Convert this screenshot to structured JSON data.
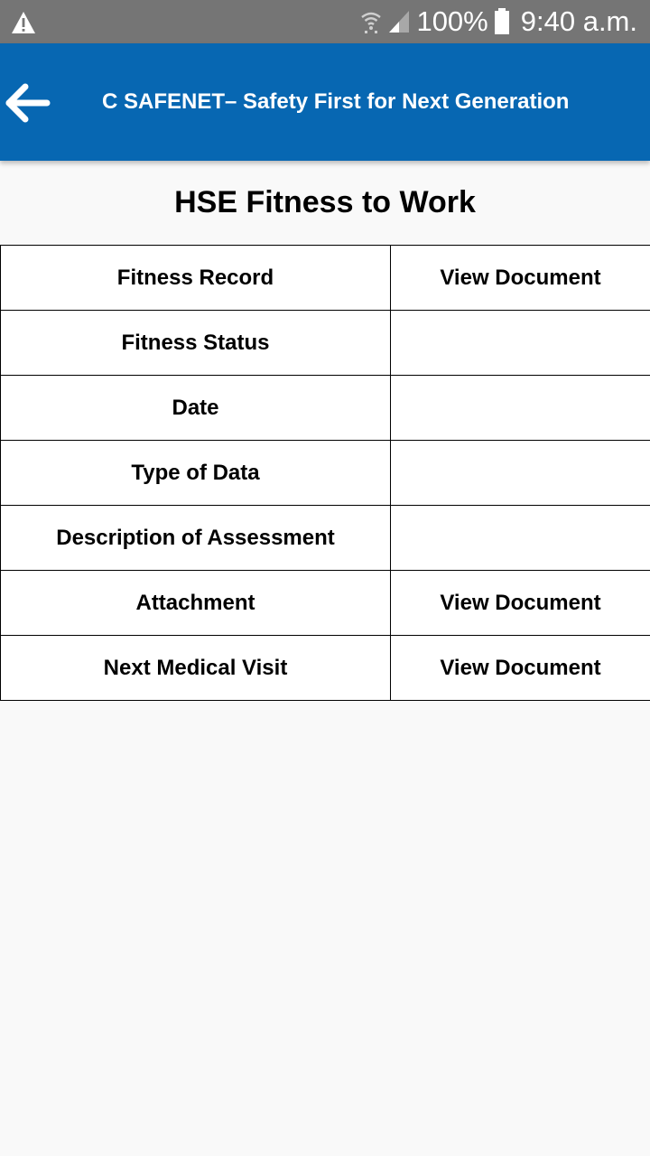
{
  "status_bar": {
    "battery": "100%",
    "time": "9:40 a.m.",
    "icons": [
      "warning-icon",
      "wifi-icon",
      "signal-icon",
      "battery-icon"
    ]
  },
  "app_bar": {
    "title": "C SAFENET– Safety First for Next Generation",
    "color": "#0767b2"
  },
  "page": {
    "title": "HSE Fitness to Work"
  },
  "table": {
    "rows": [
      {
        "label": "Fitness Record",
        "value": "View Document"
      },
      {
        "label": "Fitness Status",
        "value": ""
      },
      {
        "label": "Date",
        "value": ""
      },
      {
        "label": "Type of Data",
        "value": ""
      },
      {
        "label": "Description of Assessment",
        "value": ""
      },
      {
        "label": "Attachment",
        "value": "View Document"
      },
      {
        "label": "Next Medical Visit",
        "value": "View Document"
      }
    ]
  }
}
